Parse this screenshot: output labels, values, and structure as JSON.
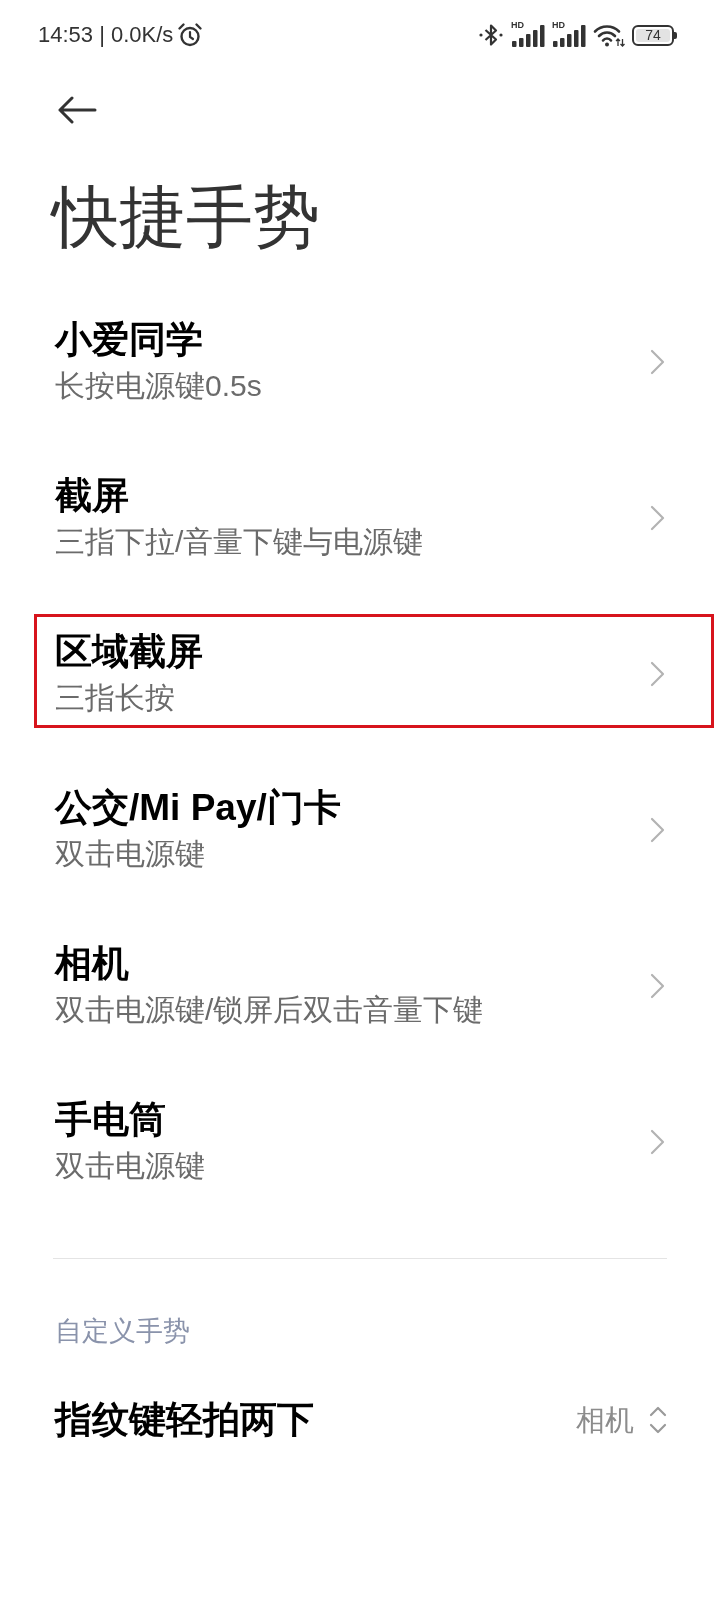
{
  "status_bar": {
    "text": "14:53 | 0.0K/s",
    "signals": [
      {
        "label": "HD"
      },
      {
        "label": "HD"
      }
    ],
    "battery": "74"
  },
  "title": "快捷手势",
  "items": [
    {
      "title": "小爱同学",
      "subtitle": "长按电源键0.5s",
      "highlighted": false
    },
    {
      "title": "截屏",
      "subtitle": "三指下拉/音量下键与电源键",
      "highlighted": false
    },
    {
      "title": "区域截屏",
      "subtitle": "三指长按",
      "highlighted": true
    },
    {
      "title": "公交/Mi Pay/门卡",
      "subtitle": "双击电源键",
      "highlighted": false
    },
    {
      "title": "相机",
      "subtitle": "双击电源键/锁屏后双击音量下键",
      "highlighted": false
    },
    {
      "title": "手电筒",
      "subtitle": "双击电源键",
      "highlighted": false
    }
  ],
  "section": {
    "header": "自定义手势",
    "items": [
      {
        "title": "指纹键轻拍两下",
        "value": "相机"
      }
    ]
  }
}
